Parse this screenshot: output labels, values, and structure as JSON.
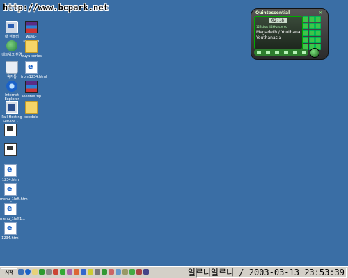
{
  "watermark": "http://www.bcpark.net",
  "desktop_icons": [
    {
      "name": "my-computer",
      "label": "내 컴퓨터"
    },
    {
      "name": "rar-file-1",
      "label": "wuyu-series.rar"
    },
    {
      "name": "network-places",
      "label": "네트워크 환경"
    },
    {
      "name": "folder-1",
      "label": "wuyu-series"
    },
    {
      "name": "recycle-bin",
      "label": "휴지통"
    },
    {
      "name": "html-file-1",
      "label": "from1234.html"
    },
    {
      "name": "internet-explorer",
      "label": "Internet Explorer"
    },
    {
      "name": "rar-file-2",
      "label": "seedble.zip"
    },
    {
      "name": "hosting-service",
      "label": "Pall Hosting Service -..."
    },
    {
      "name": "folder-2",
      "label": "seedble"
    },
    {
      "name": "doc-file-1",
      "label": ""
    },
    {
      "name": "doc-file-2",
      "label": ""
    },
    {
      "name": "html-file-2",
      "label": "1234.htm"
    },
    {
      "name": "html-file-3",
      "label": "menu_1left.htm"
    },
    {
      "name": "html-file-4",
      "label": "menu_1left1..."
    },
    {
      "name": "html-file-5",
      "label": "1234.html"
    }
  ],
  "player": {
    "title": "Quintessential",
    "time": "02:18",
    "line1": "Megadeth / Youthana",
    "line2": "Youthanasia",
    "info_small": "128kbps 44kHz stereo"
  },
  "taskbar": {
    "start_label": "시작",
    "clock": "일르니일르니 / 2003-03-13 23:53:39"
  },
  "colors": {
    "desktop_bg": "#3a6ea5",
    "taskbar_bg": "#d4d0c8",
    "player_accent": "#3ec44a"
  }
}
